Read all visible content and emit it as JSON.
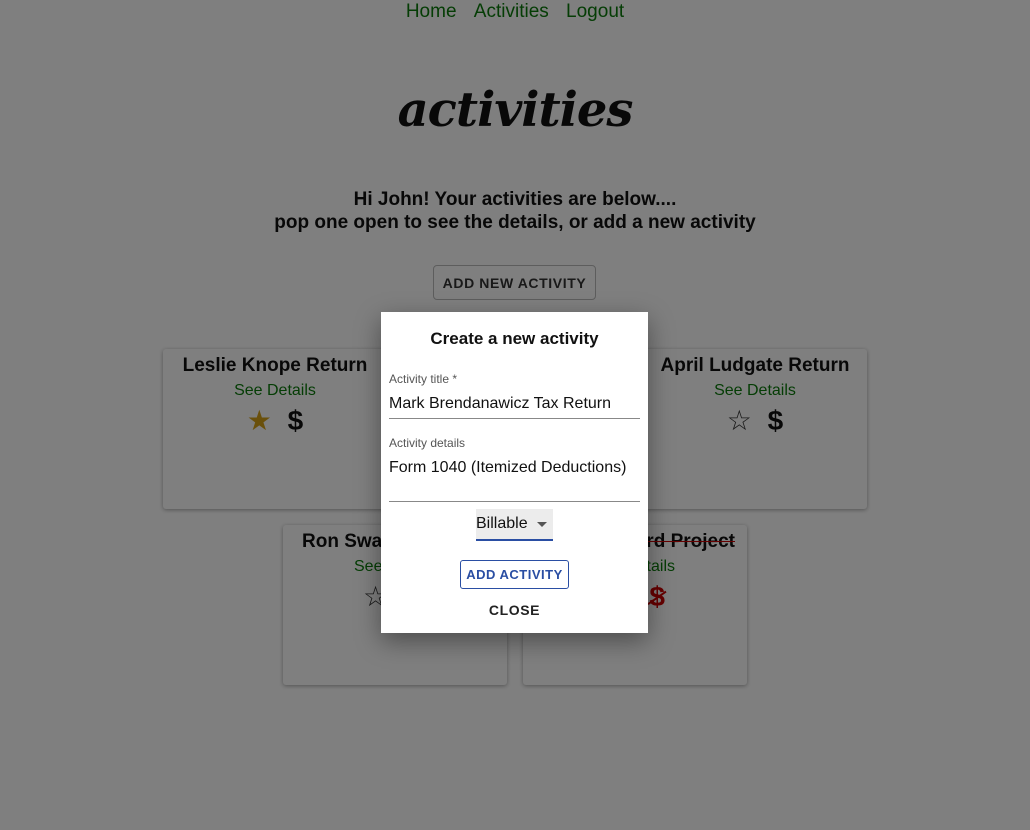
{
  "nav": {
    "home": "Home",
    "activities": "Activities",
    "logout": "Logout"
  },
  "logo": "activities",
  "greeting": {
    "line1": "Hi John! Your activities are below....",
    "line2": "pop one open to see the details, or add a new activity"
  },
  "add_button": "ADD NEW ACTIVITY",
  "cards": [
    {
      "title": "Leslie Knope Return",
      "link": "See Details",
      "favorite": true,
      "billable": true
    },
    {
      "title": "April Ludgate Return",
      "link": "See Details",
      "favorite": false,
      "billable": true
    },
    {
      "title": "Ron Swan",
      "link": "See",
      "favorite": false,
      "billable": true
    },
    {
      "title": "rd Project",
      "link": "tails",
      "favorite": false,
      "billable": false
    }
  ],
  "icons": {
    "star_filled": "★",
    "star_empty": "☆",
    "dollar": "$"
  },
  "colors": {
    "link": "#0a7a0a",
    "favorite": "#d4a017",
    "not_billable": "#c00",
    "primary": "#2a4ea3"
  },
  "modal": {
    "title": "Create a new activity",
    "title_label": "Activity title *",
    "title_value": "Mark Brendanawicz Tax Return",
    "details_label": "Activity details",
    "details_value": "Form 1040 (Itemized Deductions)",
    "billing_selected": "Billable",
    "submit_label": "ADD ACTIVITY",
    "close_label": "CLOSE"
  }
}
